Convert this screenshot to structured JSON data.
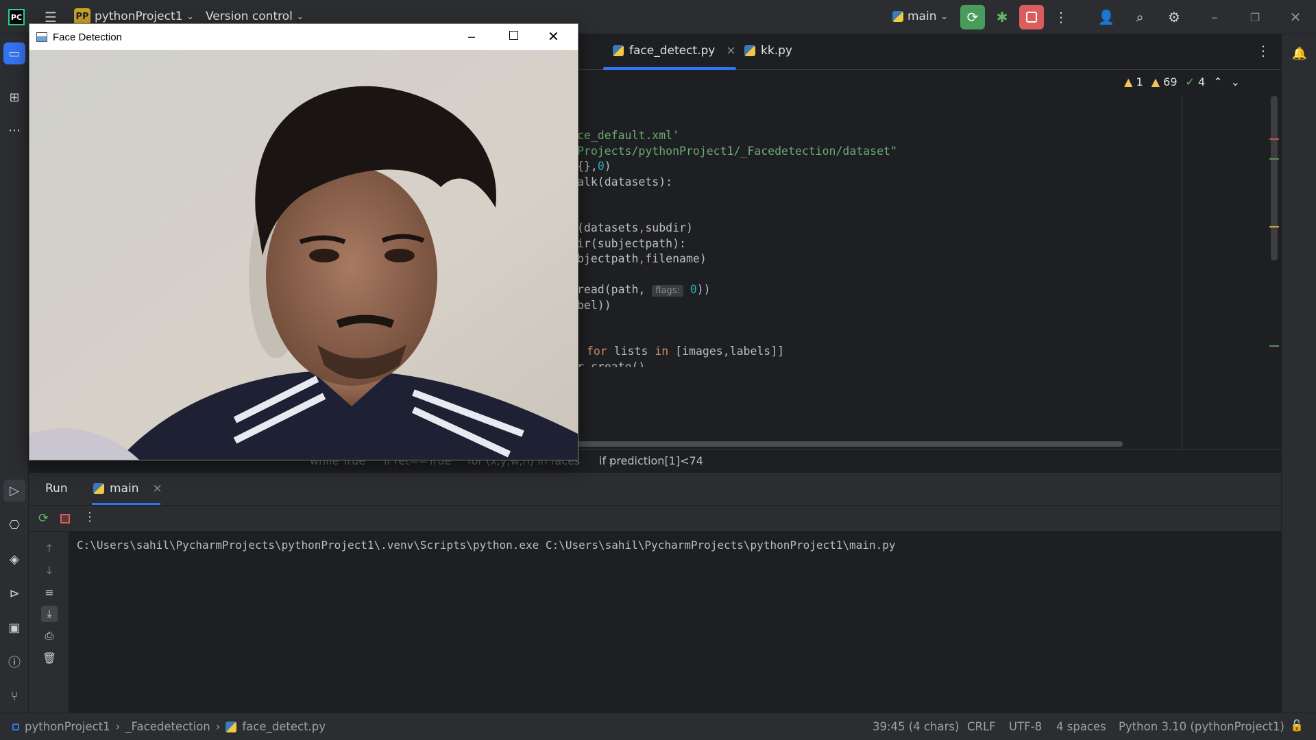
{
  "titlebar": {
    "project_badge": "PP",
    "project_name": "pythonProject1",
    "version_control": "Version control",
    "run_config": "main"
  },
  "editor": {
    "tabs": [
      {
        "label": "face_detect.py",
        "close": "×"
      },
      {
        "label": "kk.py"
      }
    ],
    "inspections": {
      "errors": "1",
      "warnings": "69",
      "ok": "4"
    },
    "code": {
      "l1": "ce_default.xml'",
      "l2": "Projects/pythonProject1/_Facedetection/dataset\"",
      "l3a": "{},",
      "l3b": "0",
      "l3c": ")",
      "l4": "alk(datasets):",
      "l5a": "(datasets",
      "l5b": ",",
      "l5c": "subdir)",
      "l6": "ir(subjectpath):",
      "l7a": "bjectpath",
      "l7b": ",",
      "l7c": "filename)",
      "l8a": "read(path,",
      "l8hint": "flags:",
      "l8b": "0",
      "l8c": "))",
      "l9": "bel))",
      "l10a": "for",
      "l10b": "lists",
      "l10c": "in",
      "l10d": "[images,labels]]",
      "l11": "r.create()"
    }
  },
  "breadcrumbs": {
    "items": [
      "while True",
      "if ret==True",
      "for (x,y,w,h) in faces",
      "if prediction[1]<74"
    ]
  },
  "run": {
    "tab_run": "Run",
    "tab_main": "main",
    "command": "C:\\Users\\sahil\\PycharmProjects\\pythonProject1\\.venv\\Scripts\\python.exe C:\\Users\\sahil\\PycharmProjects\\pythonProject1\\main.py"
  },
  "statusbar": {
    "path": [
      "pythonProject1",
      "_Facedetection",
      "face_detect.py"
    ],
    "position": "39:45 (4 chars)",
    "line_sep": "CRLF",
    "encoding": "UTF-8",
    "indent": "4 spaces",
    "interpreter": "Python 3.10 (pythonProject1)"
  },
  "face_window": {
    "title": "Face Detection"
  },
  "colors": {
    "accent": "#3574f0",
    "run_green": "#4a9c5d",
    "stop_red": "#db5c5c"
  }
}
